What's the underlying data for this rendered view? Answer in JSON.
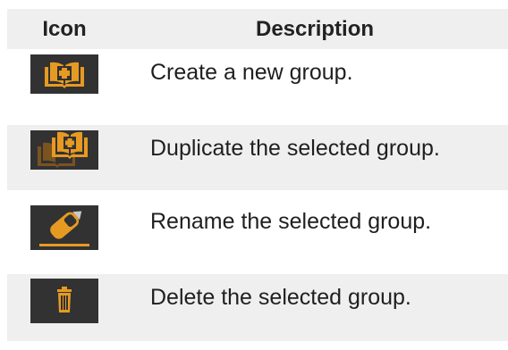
{
  "table": {
    "headers": {
      "icon": "Icon",
      "description": "Description"
    },
    "rows": [
      {
        "icon": "new-group-icon",
        "description": "Create a new group."
      },
      {
        "icon": "duplicate-group-icon",
        "description": "Duplicate the selected group."
      },
      {
        "icon": "rename-group-icon",
        "description": "Rename the selected group."
      },
      {
        "icon": "delete-group-icon",
        "description": "Delete the selected group."
      }
    ]
  },
  "colors": {
    "header_bg": "#efefef",
    "row_alt_bg": "#efefef",
    "icon_bg": "#323232",
    "icon_accent": "#e79a22"
  }
}
